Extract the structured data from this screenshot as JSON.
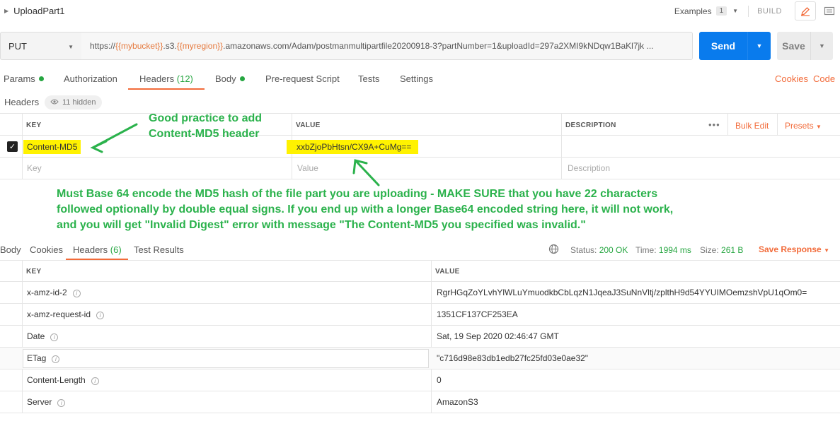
{
  "titlebar": {
    "request_name": "UploadPart1",
    "examples_label": "Examples",
    "examples_count": "1",
    "build_label": "BUILD"
  },
  "request": {
    "method": "PUT",
    "url_parts": {
      "p1": "https://",
      "v1": "{{mybucket}}",
      "p2": ".s3.",
      "v2": "{{myregion}}",
      "p3": ".amazonaws.com/Adam/postmanmultipartfile20200918-3?partNumber=1&uploadId=297a2XMI9kNDqw1BaKl7jk ..."
    },
    "send_label": "Send",
    "save_label": "Save"
  },
  "tabs": {
    "params": "Params",
    "authorization": "Authorization",
    "headers": "Headers",
    "headers_count": "(12)",
    "body": "Body",
    "prerequest": "Pre-request Script",
    "tests": "Tests",
    "settings": "Settings",
    "cookies": "Cookies",
    "code": "Code"
  },
  "headers_section": {
    "label": "Headers",
    "hidden": "11 hidden",
    "col_key": "KEY",
    "col_value": "VALUE",
    "col_description": "DESCRIPTION",
    "bulk_edit": "Bulk Edit",
    "presets": "Presets",
    "row": {
      "key": "Content-MD5",
      "value": "xxbZjoPbHtsn/CX9A+CuMg=="
    },
    "placeholders": {
      "key": "Key",
      "value": "Value",
      "description": "Description"
    }
  },
  "annotations": {
    "note1": "Good practice to add Content-MD5 header",
    "note2": "Must Base 64 encode the MD5 hash of the file part you are uploading - MAKE SURE that you have 22 characters followed optionally by double equal signs. If you end up with a longer Base64 encoded string here, it will not work, and you will get \"Invalid Digest\" error with message \"The Content-MD5 you specified was invalid.\""
  },
  "response": {
    "tabs": {
      "body": "Body",
      "cookies": "Cookies",
      "headers": "Headers",
      "headers_count": "(6)",
      "test_results": "Test Results"
    },
    "status_label": "Status:",
    "status_value": "200 OK",
    "time_label": "Time:",
    "time_value": "1994 ms",
    "size_label": "Size:",
    "size_value": "261 B",
    "save_response": "Save Response",
    "col_key": "KEY",
    "col_value": "VALUE",
    "headers": [
      {
        "key": "x-amz-id-2",
        "value": "RgrHGqZoYLvhYlWLuYmuodkbCbLqzN1JqeaJ3SuNnVltj/zplthH9d54YYUIMOemzshVpU1qOm0="
      },
      {
        "key": "x-amz-request-id",
        "value": "1351CF137CF253EA"
      },
      {
        "key": "Date",
        "value": "Sat, 19 Sep 2020 02:46:47 GMT"
      },
      {
        "key": "ETag",
        "value": "\"c716d98e83db1edb27fc25fd03e0ae32\""
      },
      {
        "key": "Content-Length",
        "value": "0"
      },
      {
        "key": "Server",
        "value": "AmazonS3"
      }
    ]
  },
  "colors": {
    "accent": "#f26b3a",
    "send_blue": "#097bed",
    "status_green": "#26a641",
    "annotation_green": "#2bb24c",
    "highlight_yellow": "#fff200"
  }
}
